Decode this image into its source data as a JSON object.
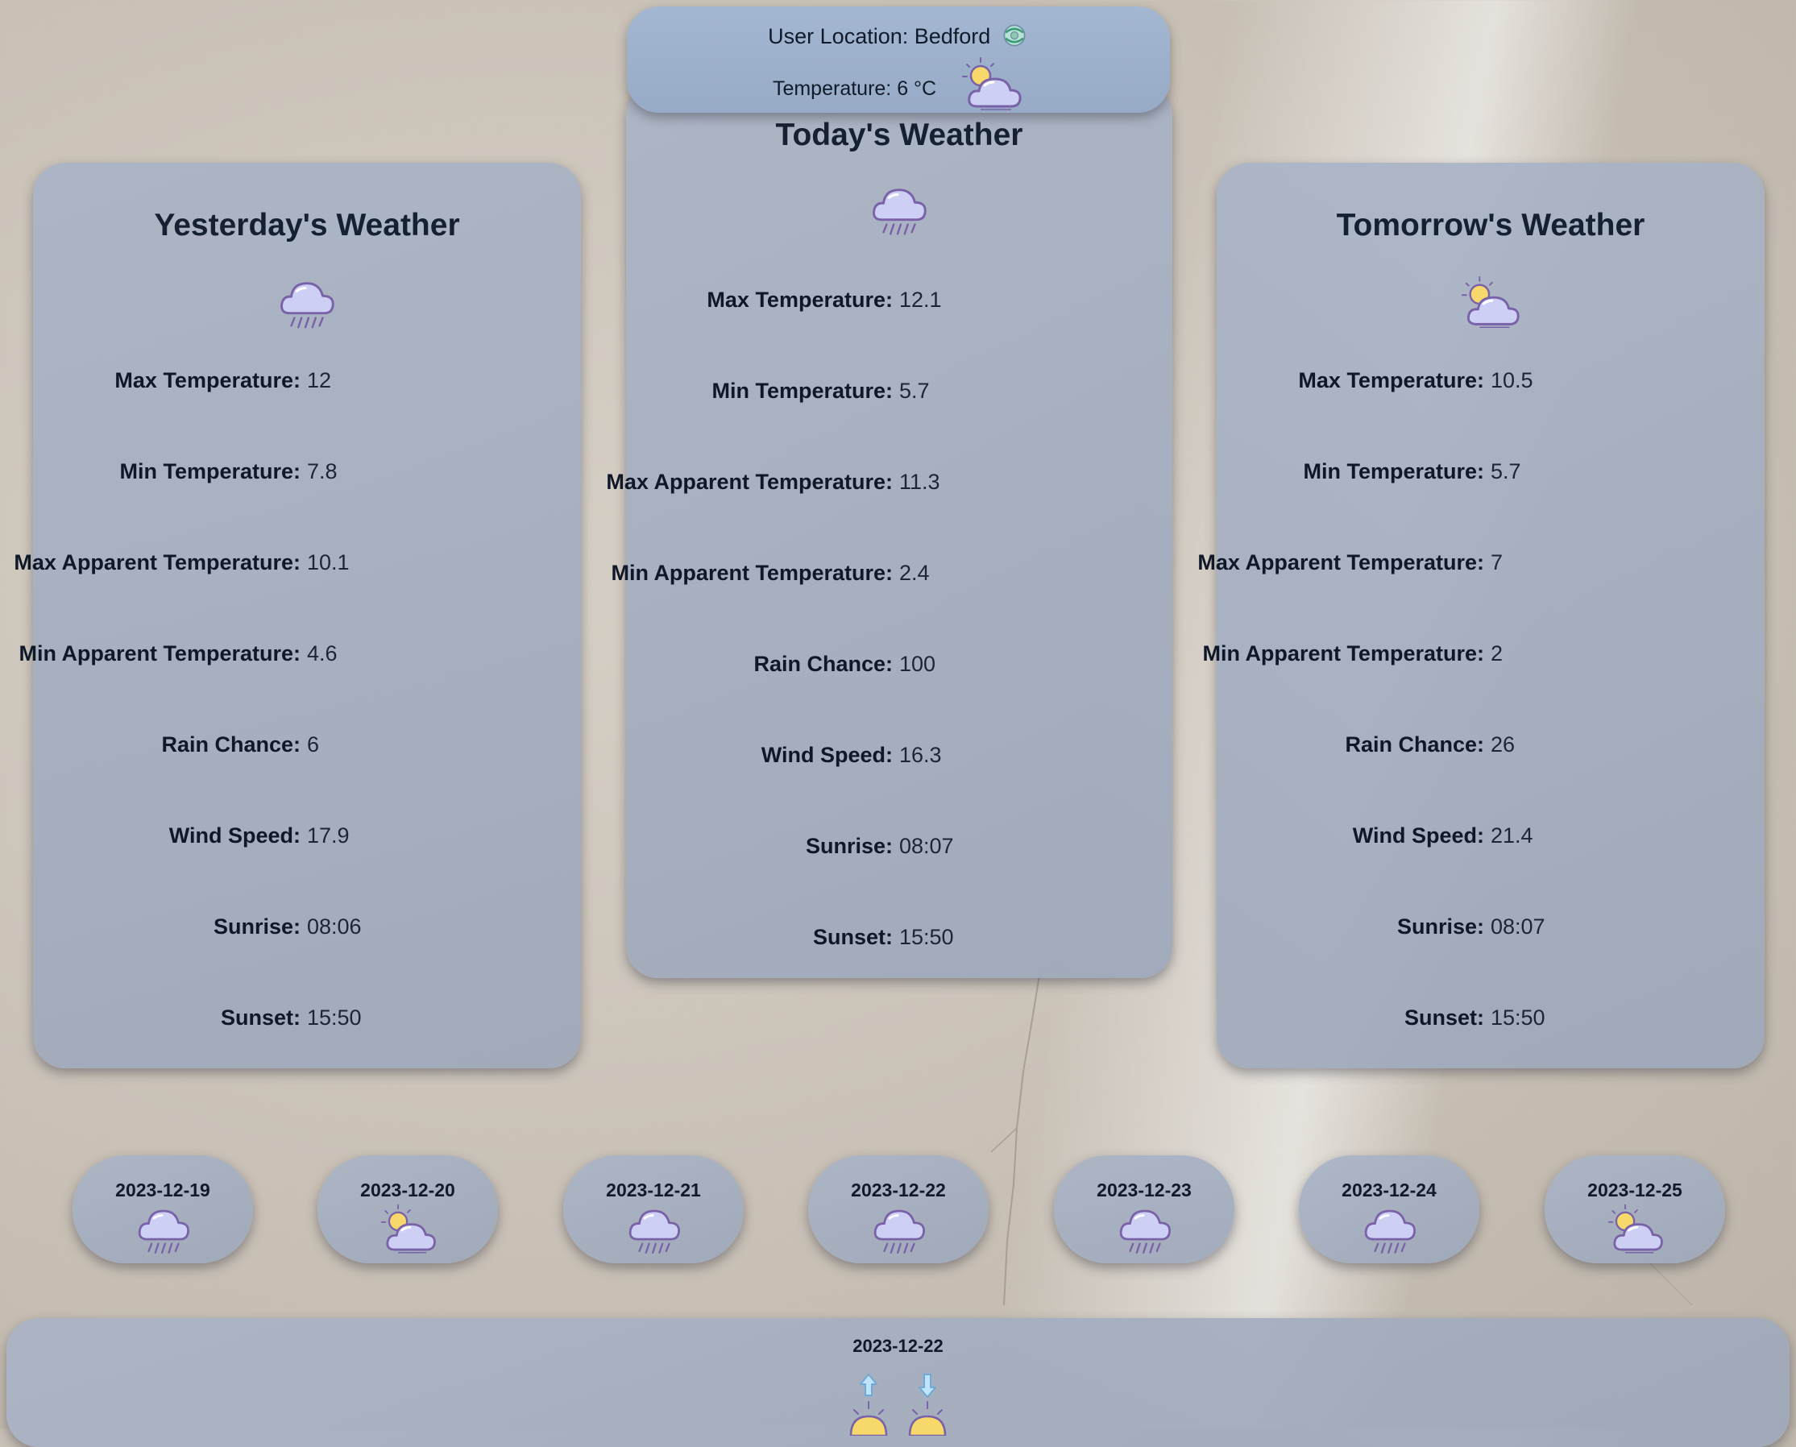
{
  "header": {
    "location_label": "User Location: Bedford",
    "temperature_label": "Temperature: 6 °C",
    "location_icon": "refresh-globe-icon",
    "weather_icon": "partly-cloudy-icon"
  },
  "panels": {
    "yesterday": {
      "title": "Yesterday's Weather",
      "icon": "rain-cloud-icon",
      "rows": [
        {
          "label": "Max Temperature:",
          "value": "12"
        },
        {
          "label": "Min Temperature:",
          "value": "7.8"
        },
        {
          "label": "Max Apparent Temperature:",
          "value": "10.1"
        },
        {
          "label": "Min Apparent Temperature:",
          "value": "4.6"
        },
        {
          "label": "Rain Chance:",
          "value": "6"
        },
        {
          "label": "Wind Speed:",
          "value": "17.9"
        },
        {
          "label": "Sunrise:",
          "value": "08:06"
        },
        {
          "label": "Sunset:",
          "value": "15:50"
        }
      ]
    },
    "today": {
      "title": "Today's Weather",
      "icon": "rain-cloud-icon",
      "rows": [
        {
          "label": "Max Temperature:",
          "value": "12.1"
        },
        {
          "label": "Min Temperature:",
          "value": "5.7"
        },
        {
          "label": "Max Apparent Temperature:",
          "value": "11.3"
        },
        {
          "label": "Min Apparent Temperature:",
          "value": "2.4"
        },
        {
          "label": "Rain Chance:",
          "value": "100"
        },
        {
          "label": "Wind Speed:",
          "value": "16.3"
        },
        {
          "label": "Sunrise:",
          "value": "08:07"
        },
        {
          "label": "Sunset:",
          "value": "15:50"
        }
      ]
    },
    "tomorrow": {
      "title": "Tomorrow's Weather",
      "icon": "partly-cloudy-icon",
      "rows": [
        {
          "label": "Max Temperature:",
          "value": "10.5"
        },
        {
          "label": "Min Temperature:",
          "value": "5.7"
        },
        {
          "label": "Max Apparent Temperature:",
          "value": "7"
        },
        {
          "label": "Min Apparent Temperature:",
          "value": "2"
        },
        {
          "label": "Rain Chance:",
          "value": "26"
        },
        {
          "label": "Wind Speed:",
          "value": "21.4"
        },
        {
          "label": "Sunrise:",
          "value": "08:07"
        },
        {
          "label": "Sunset:",
          "value": "15:50"
        }
      ]
    }
  },
  "forecast": [
    {
      "date": "2023-12-19",
      "icon": "rain-cloud-icon"
    },
    {
      "date": "2023-12-20",
      "icon": "partly-cloudy-icon"
    },
    {
      "date": "2023-12-21",
      "icon": "rain-cloud-icon"
    },
    {
      "date": "2023-12-22",
      "icon": "rain-cloud-icon"
    },
    {
      "date": "2023-12-23",
      "icon": "rain-cloud-icon"
    },
    {
      "date": "2023-12-24",
      "icon": "rain-cloud-icon"
    },
    {
      "date": "2023-12-25",
      "icon": "partly-cloudy-icon"
    }
  ],
  "detail": {
    "date": "2023-12-22",
    "icons": [
      "sunrise-icon",
      "sunset-icon"
    ]
  },
  "colors": {
    "glass_panel": "#a5afc1",
    "header_panel": "#9fb2cd",
    "icon_fill": "#c9cdf2",
    "icon_stroke": "#7a62a8",
    "sun_yellow": "#f7d86a",
    "arrow_blue": "#8ecbf0"
  }
}
